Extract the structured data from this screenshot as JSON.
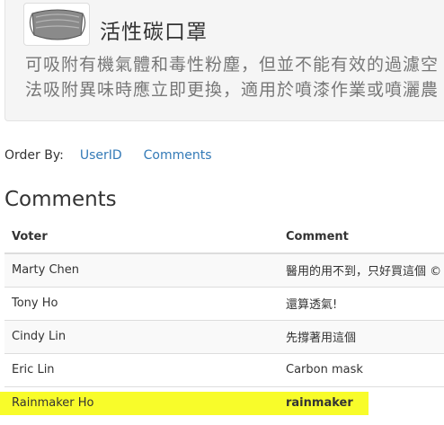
{
  "product": {
    "title": "活性碳口罩",
    "description_line1": "可吸附有機氣體和毒性粉塵，但並不能有效的過濾空",
    "description_line2": "法吸附異味時應立即更換，適用於噴漆作業或噴灑農",
    "image_icon": "mask-icon"
  },
  "order_by": {
    "label": "Order By:",
    "options": [
      "UserID",
      "Comments"
    ]
  },
  "comments": {
    "heading": "Comments",
    "columns": [
      "Voter",
      "Comment"
    ],
    "rows": [
      {
        "voter": "Marty Chen",
        "comment": "醫用的用不到，只好買這個 ©"
      },
      {
        "voter": "Tony Ho",
        "comment": "還算透氣!"
      },
      {
        "voter": "Cindy Lin",
        "comment": "先撐著用這個"
      },
      {
        "voter": "Eric Lin",
        "comment": "Carbon mask"
      },
      {
        "voter": "Rainmaker Ho",
        "comment": "rainmaker"
      }
    ]
  },
  "colors": {
    "link": "#337ab7",
    "highlight": "#ffff00",
    "card_bg": "#f5f5f5"
  }
}
